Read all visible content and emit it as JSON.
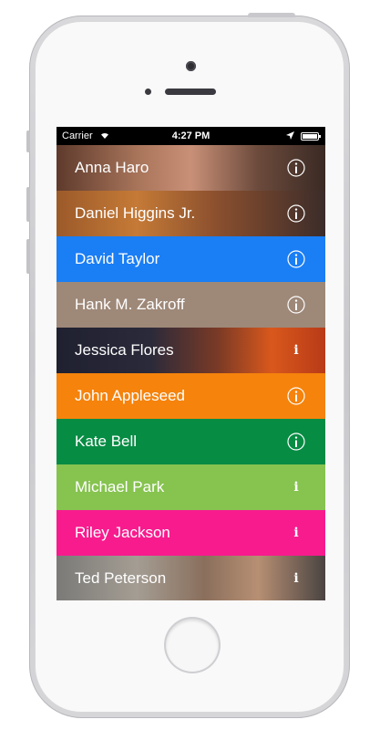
{
  "status_bar": {
    "carrier": "Carrier",
    "time": "4:27 PM",
    "wifi_icon": "wifi-icon",
    "location_icon": "location-arrow-icon",
    "battery_icon": "battery-icon",
    "battery_level": 1.0
  },
  "contacts": [
    {
      "name": "Anna Haro",
      "bg": "photo",
      "info_style": "circle"
    },
    {
      "name": "Daniel Higgins Jr.",
      "bg": "photo",
      "info_style": "circle"
    },
    {
      "name": "David Taylor",
      "bg": "#1a7ef5",
      "info_style": "circle"
    },
    {
      "name": "Hank M. Zakroff",
      "bg": "#9e8878",
      "info_style": "circle"
    },
    {
      "name": "Jessica Flores",
      "bg": "photo",
      "info_style": "plain"
    },
    {
      "name": "John Appleseed",
      "bg": "#f5830c",
      "info_style": "circle"
    },
    {
      "name": "Kate Bell",
      "bg": "#078c44",
      "info_style": "circle"
    },
    {
      "name": "Michael Park",
      "bg": "#86c34f",
      "info_style": "plain"
    },
    {
      "name": "Riley Jackson",
      "bg": "#f71b8e",
      "info_style": "plain"
    },
    {
      "name": "Ted Peterson",
      "bg": "photo",
      "info_style": "plain"
    }
  ],
  "info_icon": "info-icon"
}
